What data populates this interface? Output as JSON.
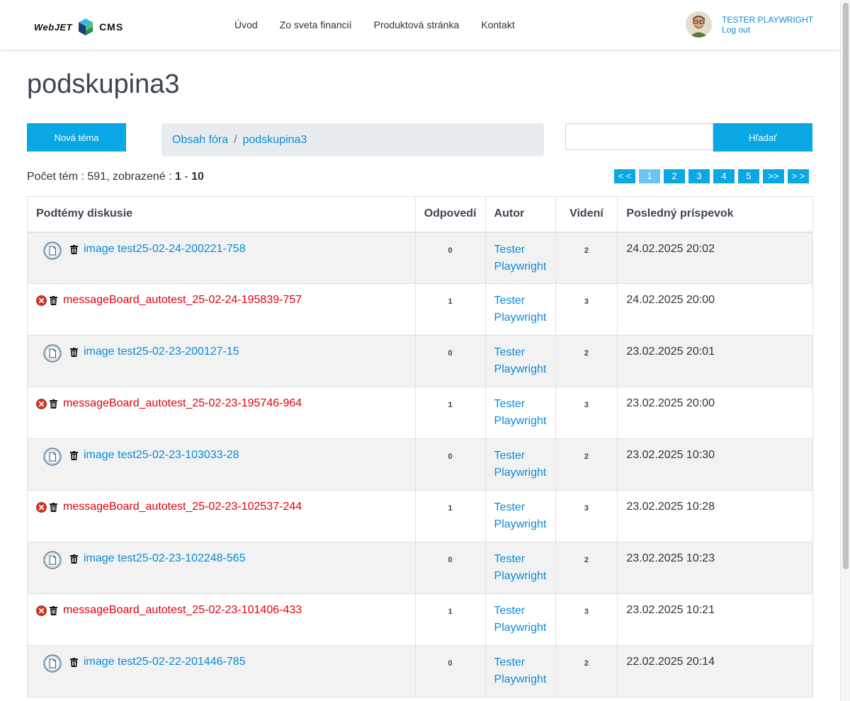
{
  "header": {
    "logo_left": "WebJET",
    "logo_right": "CMS",
    "nav": [
      "Úvod",
      "Zo sveta financií",
      "Produktová stránka",
      "Kontakt"
    ],
    "user_name": "TESTER PLAYWRIGHT",
    "logout": "Log out"
  },
  "page": {
    "title": "podskupina3",
    "new_topic_button": "Nová téma",
    "breadcrumb": [
      "Obsah fóra",
      "podskupina3"
    ],
    "search_button": "Hľadať",
    "search_value": "",
    "count_prefix": "Počet tém : 591, zobrazené : ",
    "count_from": "1",
    "count_dash": " - ",
    "count_to": "10"
  },
  "pagination": [
    "< <",
    "1",
    "2",
    "3",
    "4",
    "5",
    ">>",
    "> >"
  ],
  "pagination_active": 1,
  "table": {
    "headers": [
      "Podtémy diskusie",
      "Odpovedí",
      "Autor",
      "Videní",
      "Posledný príspevok"
    ],
    "rows": [
      {
        "type": "image",
        "title": "image test25-02-24-200221-758",
        "replies": "0",
        "author_first": "Tester",
        "author_last": "Playwright",
        "views": "2",
        "last": "24.02.2025 20:02"
      },
      {
        "type": "message",
        "title": "messageBoard_autotest_25-02-24-195839-757",
        "replies": "1",
        "author_first": "Tester",
        "author_last": "Playwright",
        "views": "3",
        "last": "24.02.2025 20:00"
      },
      {
        "type": "image",
        "title": "image test25-02-23-200127-15",
        "replies": "0",
        "author_first": "Tester",
        "author_last": "Playwright",
        "views": "2",
        "last": "23.02.2025 20:01"
      },
      {
        "type": "message",
        "title": "messageBoard_autotest_25-02-23-195746-964",
        "replies": "1",
        "author_first": "Tester",
        "author_last": "Playwright",
        "views": "3",
        "last": "23.02.2025 20:00"
      },
      {
        "type": "image",
        "title": "image test25-02-23-103033-28",
        "replies": "0",
        "author_first": "Tester",
        "author_last": "Playwright",
        "views": "2",
        "last": "23.02.2025 10:30"
      },
      {
        "type": "message",
        "title": "messageBoard_autotest_25-02-23-102537-244",
        "replies": "1",
        "author_first": "Tester",
        "author_last": "Playwright",
        "views": "3",
        "last": "23.02.2025 10:28"
      },
      {
        "type": "image",
        "title": "image test25-02-23-102248-565",
        "replies": "0",
        "author_first": "Tester",
        "author_last": "Playwright",
        "views": "2",
        "last": "23.02.2025 10:23"
      },
      {
        "type": "message",
        "title": "messageBoard_autotest_25-02-23-101406-433",
        "replies": "1",
        "author_first": "Tester",
        "author_last": "Playwright",
        "views": "3",
        "last": "23.02.2025 10:21"
      },
      {
        "type": "image",
        "title": "image test25-02-22-201446-785",
        "replies": "0",
        "author_first": "Tester",
        "author_last": "Playwright",
        "views": "2",
        "last": "22.02.2025 20:14"
      }
    ]
  },
  "colors": {
    "accent": "#09a7e4",
    "link": "#0a8bd6",
    "error": "#e3000b"
  }
}
